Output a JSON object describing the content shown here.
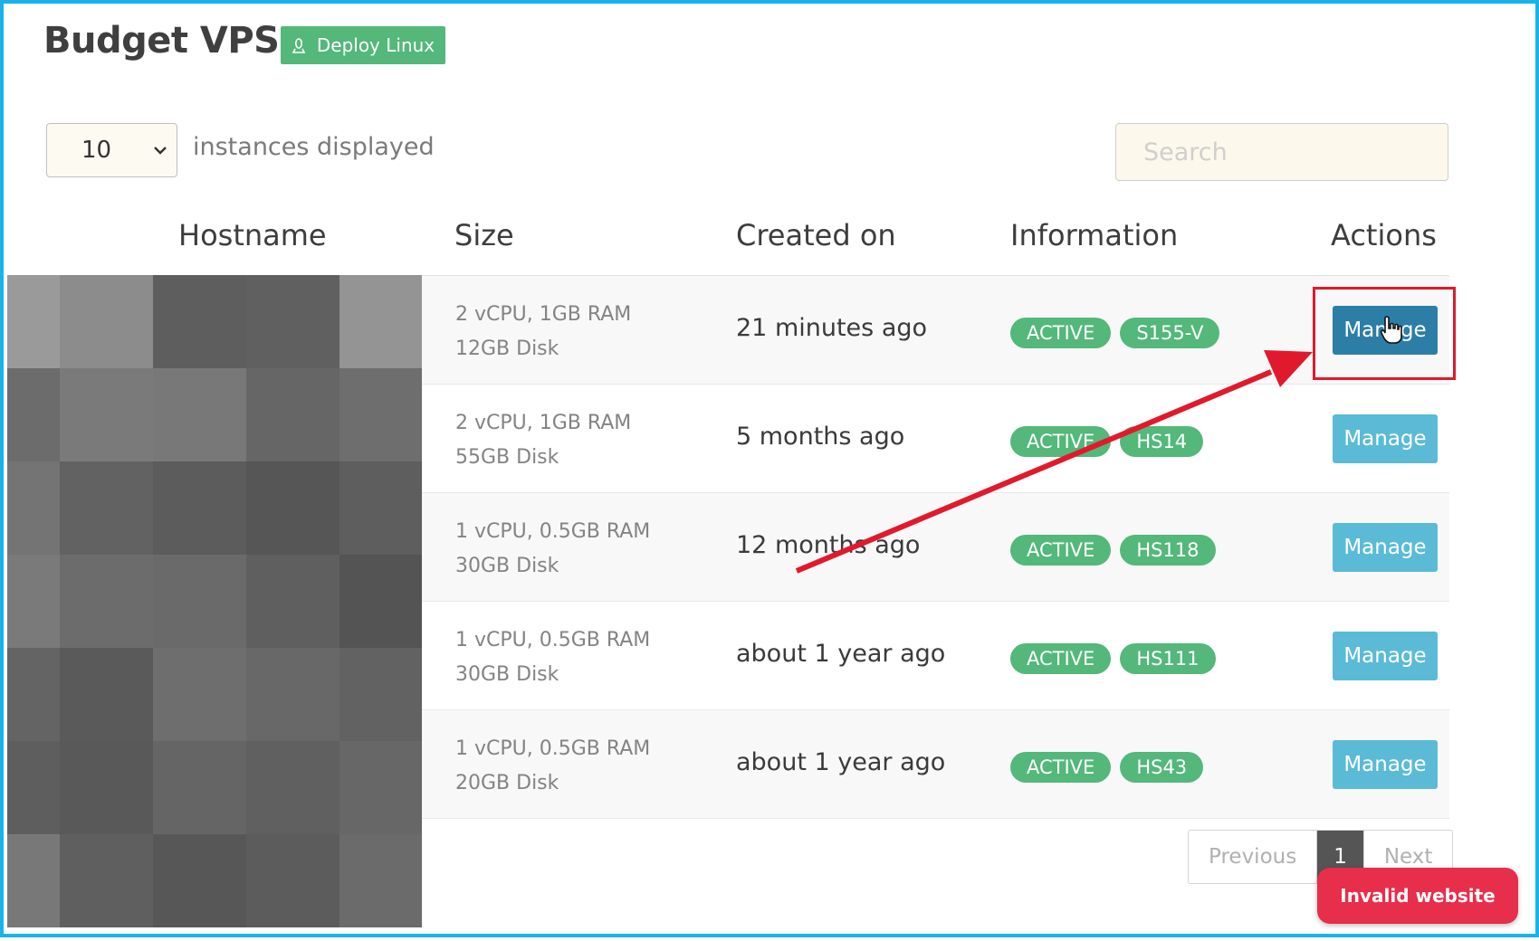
{
  "header": {
    "title": "Budget VPS",
    "deploy_button": "Deploy Linux"
  },
  "controls": {
    "page_size": "10",
    "page_size_label": "instances displayed",
    "search_placeholder": "Search"
  },
  "table": {
    "columns": [
      "Hostname",
      "Size",
      "Created on",
      "Information",
      "Actions"
    ],
    "rows": [
      {
        "size_cpu": "2 vCPU, 1GB RAM",
        "size_disk": "12GB Disk",
        "created": "21 minutes ago",
        "status": "ACTIVE",
        "location": "S155-V",
        "action": "Manage"
      },
      {
        "size_cpu": "2 vCPU, 1GB RAM",
        "size_disk": "55GB Disk",
        "created": "5 months ago",
        "status": "ACTIVE",
        "location": "HS14",
        "action": "Manage"
      },
      {
        "size_cpu": "1 vCPU, 0.5GB RAM",
        "size_disk": "30GB Disk",
        "created": "12 months ago",
        "status": "ACTIVE",
        "location": "HS118",
        "action": "Manage"
      },
      {
        "size_cpu": "1 vCPU, 0.5GB RAM",
        "size_disk": "30GB Disk",
        "created": "about 1 year ago",
        "status": "ACTIVE",
        "location": "HS111",
        "action": "Manage"
      },
      {
        "size_cpu": "1 vCPU, 0.5GB RAM",
        "size_disk": "20GB Disk",
        "created": "about 1 year ago",
        "status": "ACTIVE",
        "location": "HS43",
        "action": "Manage"
      }
    ]
  },
  "pagination": {
    "previous": "Previous",
    "current": "1",
    "next": "Next"
  },
  "toast": {
    "text": "Invalid website"
  },
  "colors": {
    "frame": "#18b4e8",
    "badge_green": "#53b87a",
    "manage_button": "#5bbbd6",
    "manage_button_active": "#2d7ea6",
    "annotation_red": "#e01a2c",
    "toast_red": "#e72e4a"
  },
  "icons": {
    "deploy": "linux-penguin-icon",
    "select": "chevron-down-icon",
    "cursor": "hand-pointer-icon"
  }
}
